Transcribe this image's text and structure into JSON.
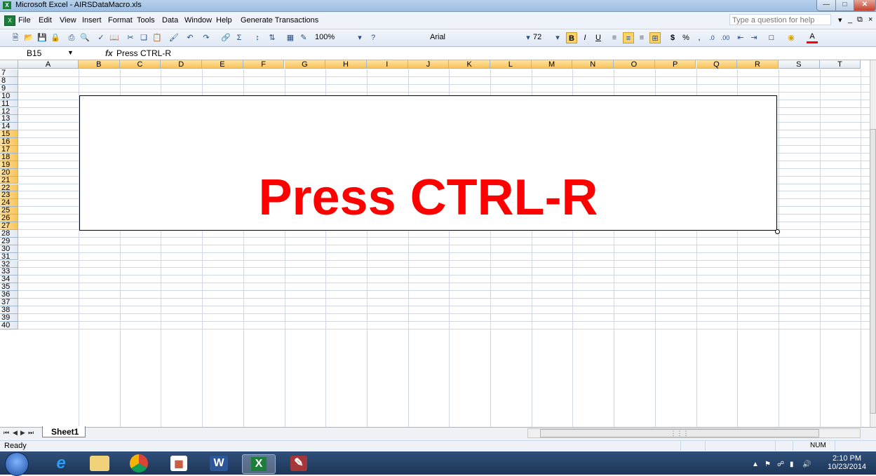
{
  "window": {
    "title": "Microsoft Excel - AIRSDataMacro.xls"
  },
  "menu": {
    "items": [
      "File",
      "Edit",
      "View",
      "Insert",
      "Format",
      "Tools",
      "Data",
      "Window",
      "Help",
      "Generate Transactions"
    ],
    "help_placeholder": "Type a question for help"
  },
  "toolbar": {
    "zoom": "100%",
    "font": "Arial",
    "font_size": "72"
  },
  "formula_bar": {
    "name_box": "B15",
    "fx": "fx",
    "formula": "Press CTRL-R"
  },
  "grid": {
    "columns": [
      "A",
      "B",
      "C",
      "D",
      "E",
      "F",
      "G",
      "H",
      "I",
      "J",
      "K",
      "L",
      "M",
      "N",
      "O",
      "P",
      "Q",
      "R",
      "S",
      "T"
    ],
    "selected_columns": [
      "B",
      "C",
      "D",
      "E",
      "F",
      "G",
      "H",
      "I",
      "J",
      "K",
      "L",
      "M",
      "N",
      "O",
      "P",
      "Q",
      "R"
    ],
    "rows": [
      "7",
      "8",
      "9",
      "10",
      "11",
      "12",
      "13",
      "14",
      "15",
      "16",
      "17",
      "18",
      "19",
      "20",
      "21",
      "22",
      "23",
      "24",
      "25",
      "26",
      "27",
      "28",
      "29",
      "30",
      "31",
      "32",
      "33",
      "34",
      "35",
      "36",
      "37",
      "38",
      "39",
      "40"
    ],
    "selected_rows": [
      "15",
      "16",
      "17",
      "18",
      "19",
      "20",
      "21",
      "22",
      "23",
      "24",
      "25",
      "26",
      "27"
    ]
  },
  "textbox": {
    "text": "Press CTRL-R",
    "color": "#ff0000"
  },
  "sheets": {
    "tabs": [
      "Sheet1"
    ]
  },
  "status": {
    "left": "Ready",
    "num": "NUM"
  },
  "taskbar": {
    "time": "2:10 PM",
    "date": "10/23/2014"
  }
}
